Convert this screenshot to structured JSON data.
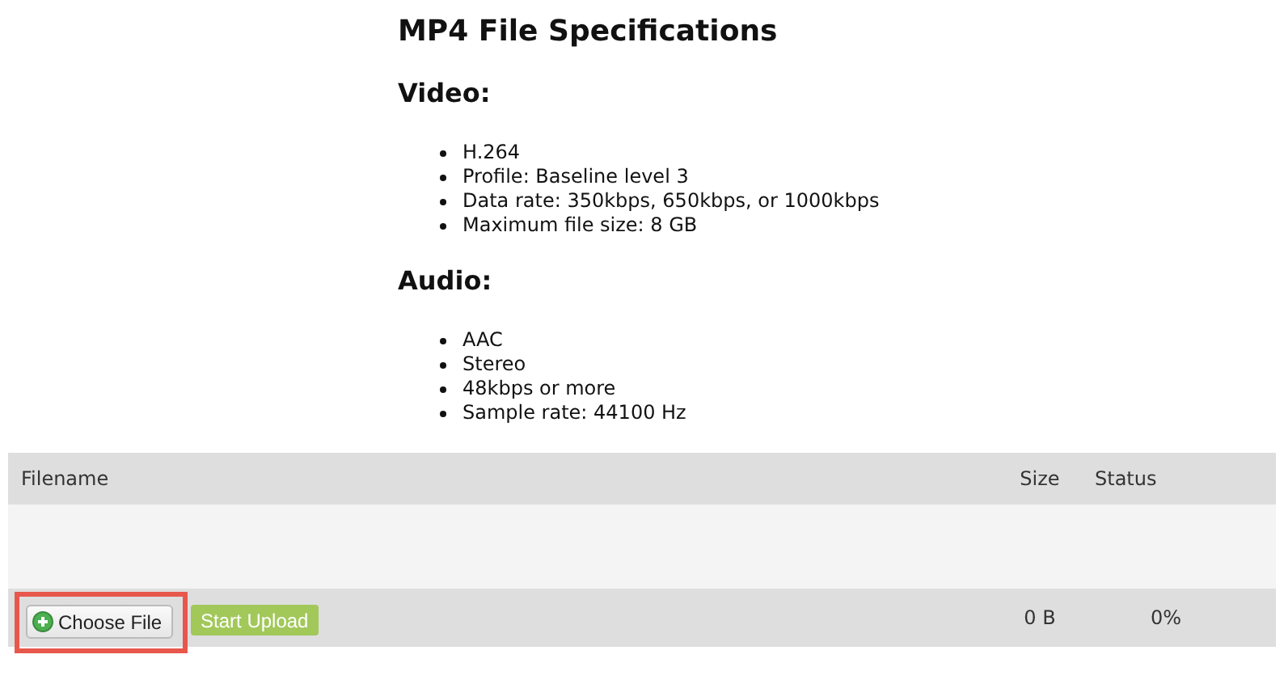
{
  "title": "MP4 File Specifications",
  "sections": [
    {
      "heading": "Video:",
      "items": [
        "H.264",
        "Profile: Baseline level 3",
        "Data rate: 350kbps, 650kbps, or 1000kbps",
        "Maximum file size: 8 GB"
      ]
    },
    {
      "heading": "Audio:",
      "items": [
        "AAC",
        "Stereo",
        "48kbps or more",
        "Sample rate: 44100 Hz"
      ]
    }
  ],
  "table": {
    "columns": [
      "Filename",
      "Size",
      "Status"
    ],
    "footer": {
      "choose_button": "Choose File",
      "upload_button": "Start Upload",
      "size": "0 B",
      "status": "0%",
      "highlighted": true
    }
  }
}
